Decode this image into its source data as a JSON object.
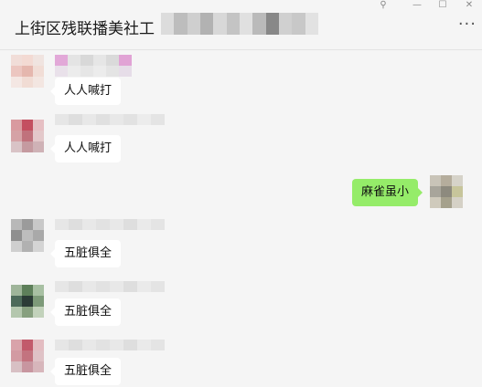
{
  "window": {
    "title": "上街区残联播美社工",
    "pin_icon": "pin-icon",
    "minimize_icon": "minimize-icon",
    "maximize_icon": "maximize-icon",
    "close_icon": "close-icon",
    "more_icon": "more-dots-icon"
  },
  "messages": [
    {
      "sender": "other",
      "text": "人人喊打"
    },
    {
      "sender": "other",
      "text": "人人喊打"
    },
    {
      "sender": "self",
      "text": "麻雀虽小"
    },
    {
      "sender": "other",
      "text": "五脏俱全"
    },
    {
      "sender": "other",
      "text": "五脏俱全"
    },
    {
      "sender": "other",
      "text": "五脏俱全"
    }
  ],
  "colors": {
    "background": "#f5f5f5",
    "bubble_other": "#ffffff",
    "bubble_self": "#95ec69"
  }
}
